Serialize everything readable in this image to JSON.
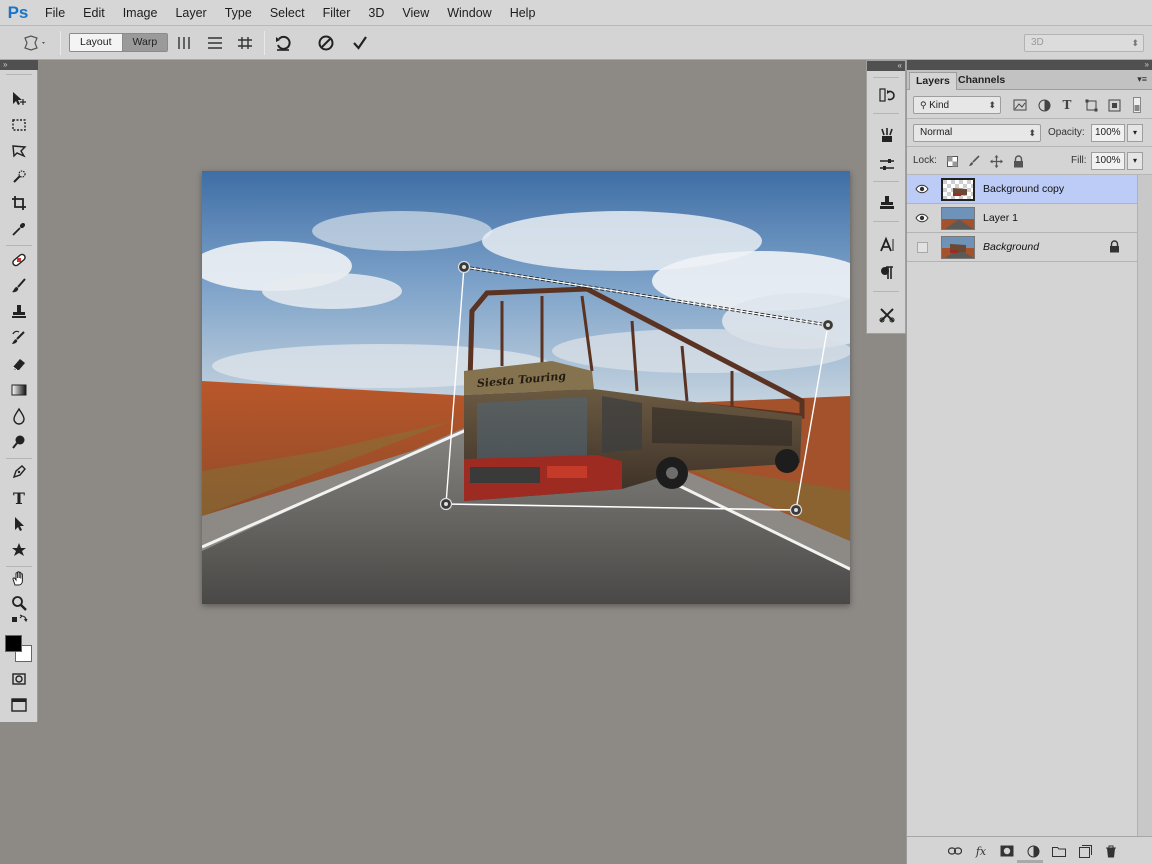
{
  "app": {
    "logo": "Ps",
    "menu": [
      "File",
      "Edit",
      "Image",
      "Layer",
      "Type",
      "Select",
      "Filter",
      "3D",
      "View",
      "Window",
      "Help"
    ]
  },
  "options_bar": {
    "layout_label": "Layout",
    "warp_label": "Warp",
    "active_mode": "Warp",
    "workspace_select": "3D"
  },
  "layers_panel": {
    "tabs": [
      "Layers",
      "Channels"
    ],
    "active_tab": "Layers",
    "filter_kind": "Kind",
    "blend_mode": "Normal",
    "opacity_label": "Opacity:",
    "opacity_value": "100%",
    "lock_label": "Lock:",
    "fill_label": "Fill:",
    "fill_value": "100%",
    "layers": [
      {
        "name": "Background copy",
        "visible": true,
        "selected": true,
        "locked": false,
        "italic": false
      },
      {
        "name": "Layer 1",
        "visible": true,
        "selected": false,
        "locked": false,
        "italic": false
      },
      {
        "name": "Background",
        "visible": false,
        "selected": false,
        "locked": true,
        "italic": true
      }
    ]
  },
  "canvas": {
    "bus_sign_text": "Siesta Touring"
  },
  "colors": {
    "selection": "#bcccf6",
    "ps_blue": "#1c73c7",
    "panel": "#d4d4d4",
    "workspace": "#8d8985"
  },
  "icons": {
    "tools": [
      "move-icon",
      "marquee-icon",
      "lasso-icon",
      "quick-select-icon",
      "crop-icon",
      "eyedropper-icon",
      "healing-icon",
      "brush-icon",
      "clone-stamp-icon",
      "history-brush-icon",
      "eraser-icon",
      "gradient-icon",
      "blur-icon",
      "dodge-icon",
      "pen-icon",
      "type-icon",
      "path-select-icon",
      "shape-icon",
      "hand-icon",
      "zoom-icon",
      "quick-mask-icon",
      "screen-mode-icon"
    ]
  }
}
